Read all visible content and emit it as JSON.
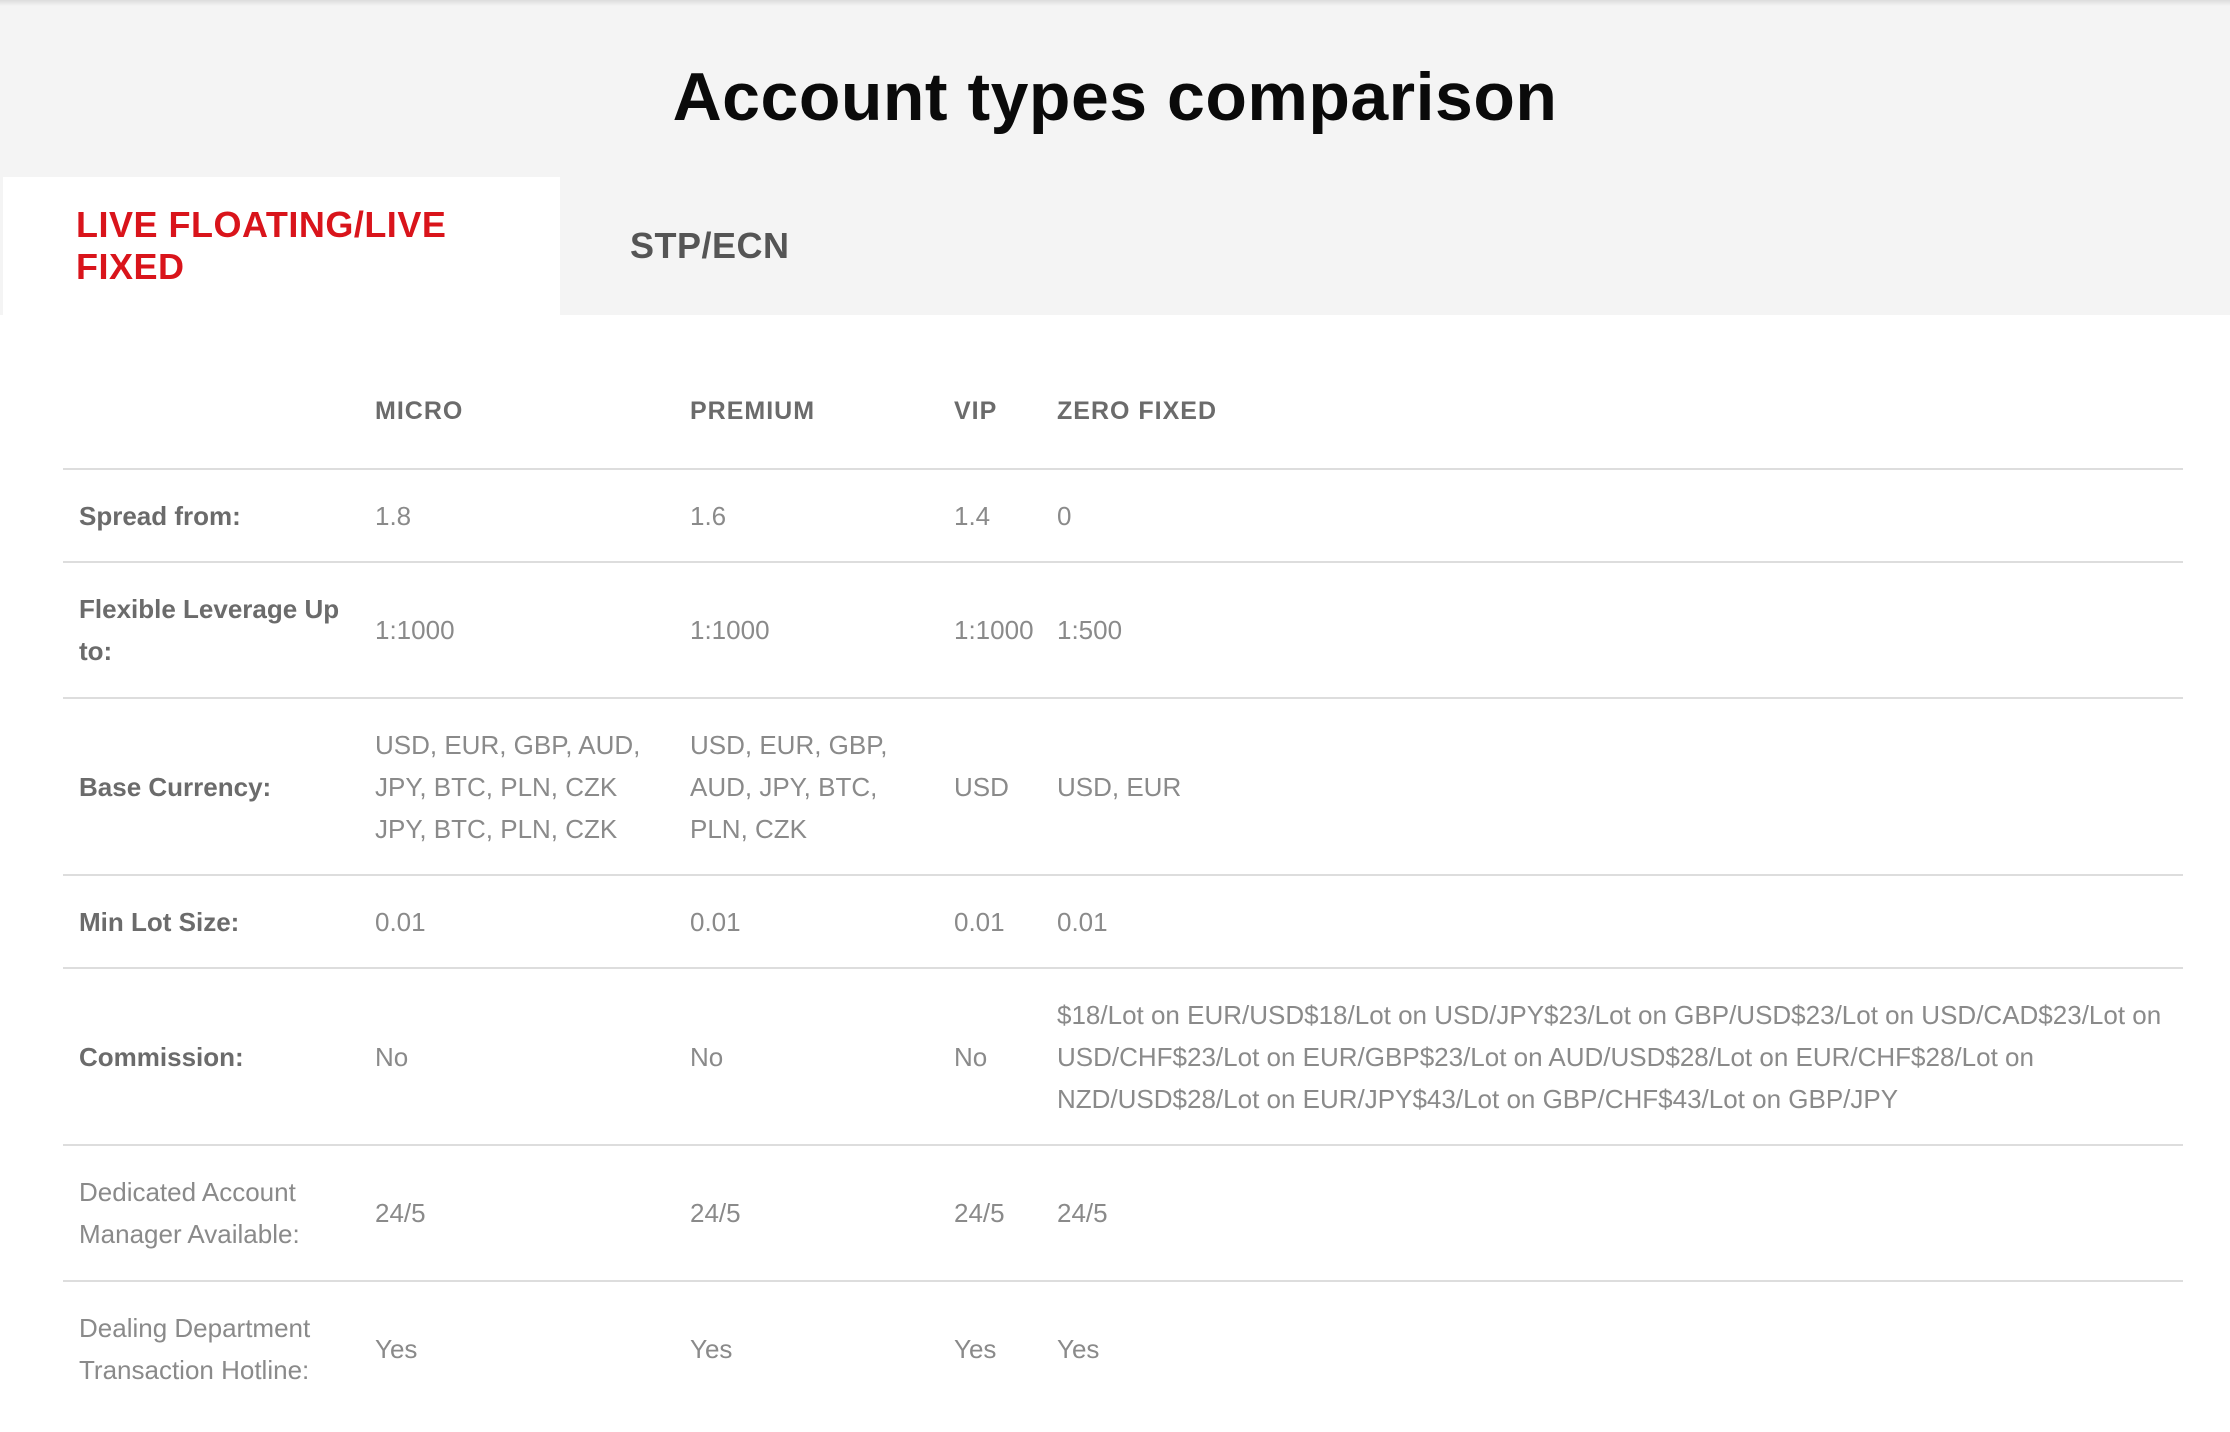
{
  "title": "Account types comparison",
  "tabs": [
    {
      "label": "LIVE FLOATING/LIVE FIXED",
      "active": true
    },
    {
      "label": "STP/ECN",
      "active": false
    }
  ],
  "colors": {
    "active_tab": "#d9141b",
    "header_bg": "#f4f4f4",
    "title": "#0a0a0a",
    "label_text": "#6b6b6b",
    "value_text": "#8a8a8a",
    "divider": "#dddddd"
  },
  "table": {
    "columns": [
      "",
      "MICRO",
      "PREMIUM",
      "VIP",
      "ZERO FIXED"
    ],
    "rows": [
      {
        "label": "Spread from:",
        "values": [
          "1.8",
          "1.6",
          "1.4",
          "0"
        ]
      },
      {
        "label": "Flexible Leverage Up to:",
        "values": [
          "1:1000",
          "1:1000",
          "1:1000",
          "1:500"
        ]
      },
      {
        "label": "Base Currency:",
        "values": [
          "USD, EUR, GBP, AUD, JPY, BTC, PLN, CZK JPY, BTC, PLN, CZK",
          "USD, EUR, GBP, AUD, JPY, BTC, PLN, CZK",
          "USD",
          "USD, EUR"
        ]
      },
      {
        "label": "Min Lot Size:",
        "values": [
          "0.01",
          "0.01",
          "0.01",
          "0.01"
        ]
      },
      {
        "label": "Commission:",
        "values": [
          "No",
          "No",
          "No",
          "$18/Lot on EUR/USD$18/Lot on USD/JPY$23/Lot on GBP/USD$23/Lot on USD/CAD$23/Lot on USD/CHF$23/Lot on EUR/GBP$23/Lot on AUD/USD$28/Lot on EUR/CHF$28/Lot on NZD/USD$28/Lot on EUR/JPY$43/Lot on GBP/CHF$43/Lot on GBP/JPY"
        ]
      },
      {
        "label": "Dedicated Account Manager Available:",
        "values": [
          "24/5",
          "24/5",
          "24/5",
          "24/5"
        ]
      },
      {
        "label": "Dealing Department Transaction Hotline:",
        "values": [
          "Yes",
          "Yes",
          "Yes",
          "Yes"
        ]
      }
    ]
  }
}
